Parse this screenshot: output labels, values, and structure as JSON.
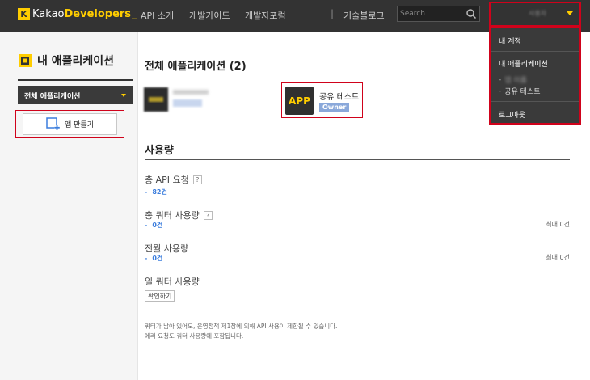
{
  "header": {
    "logo_mark": "K",
    "logo_kakao": "Kakao",
    "logo_developers": "Developers",
    "logo_underscore": "_",
    "nav": [
      "API 소개",
      "개발가이드",
      "개발자포럼"
    ],
    "nav_separator": "|",
    "blog": "기술블로그",
    "search_placeholder": "Search",
    "user_name": "사용자"
  },
  "dropdown": {
    "my_account": "내 계정",
    "my_apps": "내 애플리케이션",
    "app_items": [
      "앱 이름",
      "공유 테스트"
    ],
    "logout": "로그아웃"
  },
  "sidebar": {
    "title": "내 애플리케이션",
    "select_value": "전체 애플리케이션",
    "make_app": "앱 만들기"
  },
  "main": {
    "title": "전체 애플리케이션 (2)",
    "apps": [
      {
        "name": "앱 이름",
        "badge": "Owner"
      },
      {
        "name": "공유 테스트",
        "badge": "Owner",
        "thumb": "APP"
      }
    ],
    "usage_title": "사용량",
    "usage": [
      {
        "label": "총 API 요청",
        "help": "?",
        "value": "82건",
        "max": ""
      },
      {
        "label": "총 쿼터 사용량",
        "help": "?",
        "value": "0건",
        "max": "최대 0건"
      },
      {
        "label": "전월 사용량",
        "help": "",
        "value": "0건",
        "max": "최대 0건"
      },
      {
        "label": "일 쿼터 사용량",
        "help": "",
        "value": "",
        "max": ""
      }
    ],
    "value_dash": "-",
    "confirm_button": "확인하기",
    "notice": [
      "쿼터가 남아 있어도, 운영정책 제1장에 의해 API 사용이 제한될 수 있습니다.",
      "에러 요청도 쿼터 사용량에 포함됩니다."
    ]
  }
}
